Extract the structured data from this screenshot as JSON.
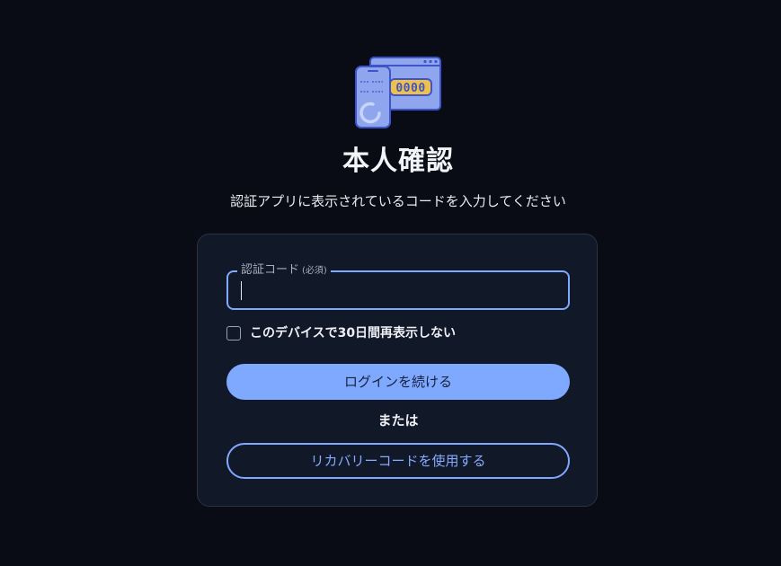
{
  "header": {
    "illustration_icon": "phone-and-browser-code-icon",
    "illustration_code": "0000",
    "title": "本人確認",
    "subtitle": "認証アプリに表示されているコードを入力してください"
  },
  "form": {
    "code_field": {
      "label": "認証コード",
      "required_label": "(必須)",
      "value": ""
    },
    "remember_device": {
      "label": "このデバイスで30日間再表示しない",
      "checked": false
    },
    "continue_button": "ログインを続ける",
    "or_text": "または",
    "recovery_button": "リカバリーコードを使用する"
  },
  "colors": {
    "background": "#090b15",
    "card": "#111827",
    "accent": "#7fa8ff",
    "illustration_fill": "#8fa6ef",
    "illustration_stroke": "#3d55c9",
    "illustration_highlight": "#f0c14a"
  }
}
